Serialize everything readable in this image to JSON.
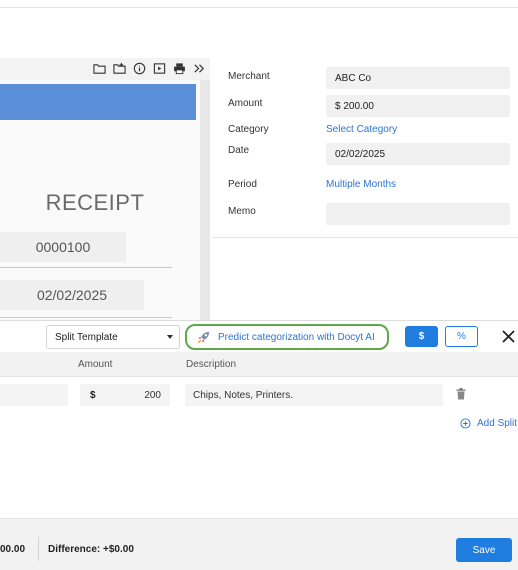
{
  "viewer": {
    "toolbar_icons": [
      "folder-icon",
      "folder-plus-icon",
      "info-icon",
      "image-icon",
      "print-icon",
      "chevrons-right-icon"
    ],
    "receipt_title": "RECEIPT",
    "receipt_number": "0000100",
    "receipt_date": "02/02/2025",
    "header_color": "#5b8fd8"
  },
  "form": {
    "merchant_label": "Merchant",
    "merchant_value": "ABC Co",
    "amount_label": "Amount",
    "amount_value": "$ 200.00",
    "category_label": "Category",
    "category_link": "Select Category",
    "date_label": "Date",
    "date_value": "02/02/2025",
    "period_label": "Period",
    "period_link": "Multiple Months",
    "memo_label": "Memo",
    "memo_value": ""
  },
  "split_bar": {
    "template_select": "Split Template",
    "predict_label": "Predict categorization with Docyt AI",
    "dollar_label": "$",
    "percent_label": "%",
    "predict_border_color": "#5ea84a",
    "accent_color": "#1f7de0"
  },
  "table": {
    "headers": {
      "amount": "Amount",
      "description": "Description"
    },
    "rows": [
      {
        "currency": "$",
        "amount": "200",
        "description": "Chips, Notes, Printers."
      }
    ],
    "add_split_label": "Add Split"
  },
  "footer": {
    "total_partial": "00.00",
    "difference": "Difference: +$0.00",
    "save_label": "Save"
  }
}
